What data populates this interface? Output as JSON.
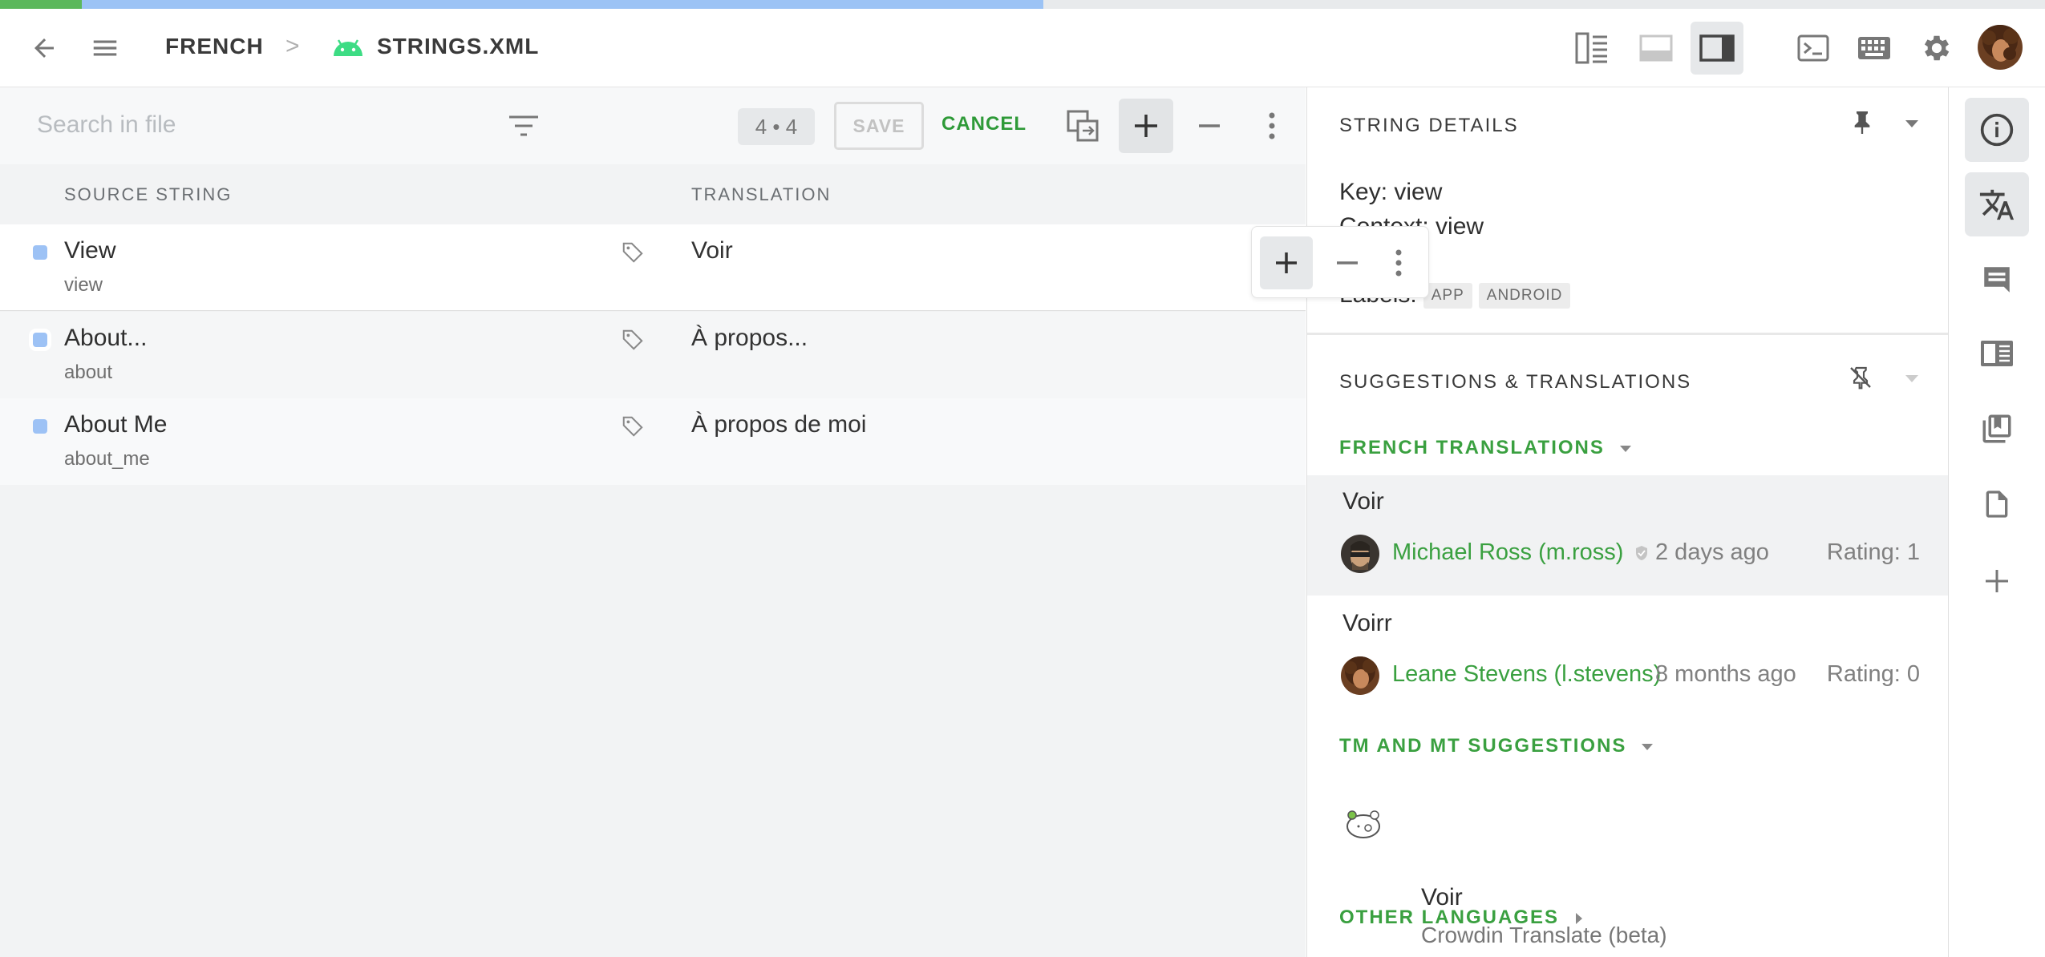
{
  "header": {
    "breadcrumb_language": "FRENCH",
    "breadcrumb_sep": ">",
    "breadcrumb_file": "STRINGS.XML",
    "icons": [
      "back-arrow-icon",
      "menu-icon",
      "android-icon",
      "layout-side-by-side-icon",
      "layout-horizontal-icon",
      "layout-vertical-icon",
      "terminal-icon",
      "keyboard-icon",
      "gear-icon",
      "avatar"
    ],
    "progress": {
      "approved": 0.04,
      "translated": 0.51
    },
    "colors": {
      "green": "#5cb85c",
      "blue": "#9cc3f5"
    }
  },
  "toolbar": {
    "search_placeholder": "Search in file",
    "counter": "4 • 4",
    "save_label": "SAVE",
    "cancel_label": "CANCEL"
  },
  "table": {
    "col_source": "SOURCE STRING",
    "col_translation": "TRANSLATION",
    "rows": [
      {
        "source": "View",
        "key": "view",
        "translation": "Voir"
      },
      {
        "source": "About...",
        "key": "about",
        "translation": "À propos..."
      },
      {
        "source": "About Me",
        "key": "about_me",
        "translation": "À propos de moi"
      }
    ]
  },
  "details": {
    "title": "STRING DETAILS",
    "key_line": "Key: view",
    "context_line": "Context: view",
    "labels_label": "Labels:",
    "labels": [
      "APP",
      "ANDROID"
    ]
  },
  "suggestions": {
    "title": "SUGGESTIONS & TRANSLATIONS",
    "french_head": "FRENCH TRANSLATIONS",
    "items": [
      {
        "text": "Voir",
        "author": "Michael Ross (m.ross)",
        "time": "2 days ago",
        "rating": "Rating: 1"
      },
      {
        "text": "Voirr",
        "author": "Leane Stevens (l.stevens)",
        "time": "8 months ago",
        "rating": "Rating: 0"
      }
    ],
    "tm_head": "TM AND MT SUGGESTIONS",
    "tm_item": {
      "text": "Voir",
      "source": "Crowdin Translate (beta)"
    },
    "other_head": "OTHER LANGUAGES"
  },
  "rail": [
    "info-icon",
    "translate-icon",
    "comment-icon",
    "glossary-icon",
    "tm-icon",
    "file-icon",
    "add-icon"
  ]
}
